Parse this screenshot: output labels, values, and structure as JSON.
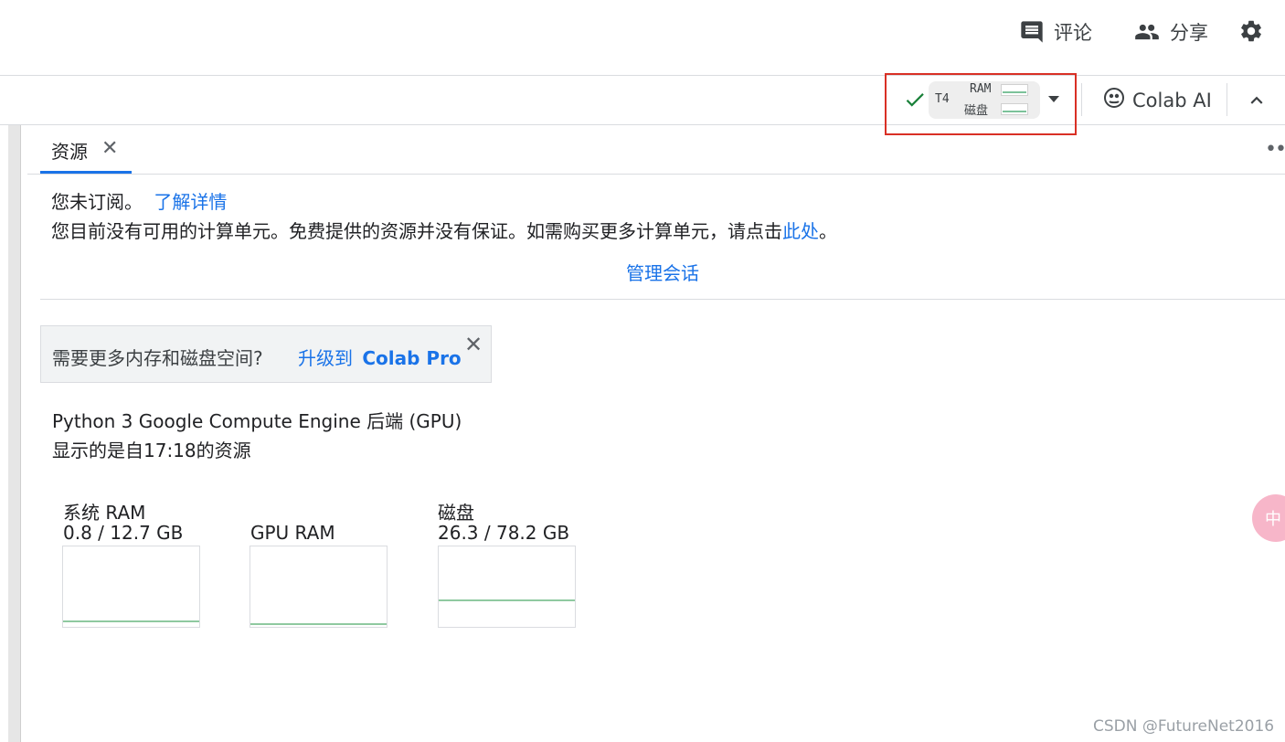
{
  "header": {
    "comment_label": "评论",
    "share_label": "分享"
  },
  "toolbar": {
    "runtime": {
      "accelerator": "T4",
      "ram_label": "RAM",
      "disk_label": "磁盘",
      "ram_usage": 0.06,
      "disk_usage": 0.34
    },
    "colab_ai_label": "Colab AI"
  },
  "panel": {
    "tab_label": "资源",
    "subscription": {
      "status": "您未订阅。",
      "learn_more": "了解详情",
      "message": "您目前没有可用的计算单元。免费提供的资源并没有保证。如需购买更多计算单元，请点击",
      "here_link": "此处",
      "period": "。"
    },
    "manage_sessions": "管理会话",
    "promo": {
      "question": "需要更多内存和磁盘空间?",
      "upgrade_prefix": "升级到",
      "upgrade_product": "Colab Pro"
    },
    "backend": "Python 3 Google Compute Engine 后端 (GPU)",
    "since": "显示的是自17:18的资源",
    "resources": [
      {
        "name": "系统 RAM",
        "value": "0.8 / 12.7 GB",
        "fraction": 0.063
      },
      {
        "name": "GPU RAM",
        "value": "",
        "fraction": 0.0
      },
      {
        "name": "磁盘",
        "value": "26.3 / 78.2 GB",
        "fraction": 0.336
      }
    ]
  },
  "fab_text": "中",
  "watermark": "CSDN @FutureNet2016",
  "colors": {
    "accent": "#1a73e8",
    "highlight": "#d93025",
    "usage_line": "#8fc9a0",
    "check": "#188038"
  },
  "icons": [
    "comment-icon",
    "people-icon",
    "gear-icon",
    "check-icon",
    "chevron-down-icon",
    "colab-ai-icon",
    "chevron-up-icon",
    "close-icon",
    "more-horiz-icon"
  ]
}
